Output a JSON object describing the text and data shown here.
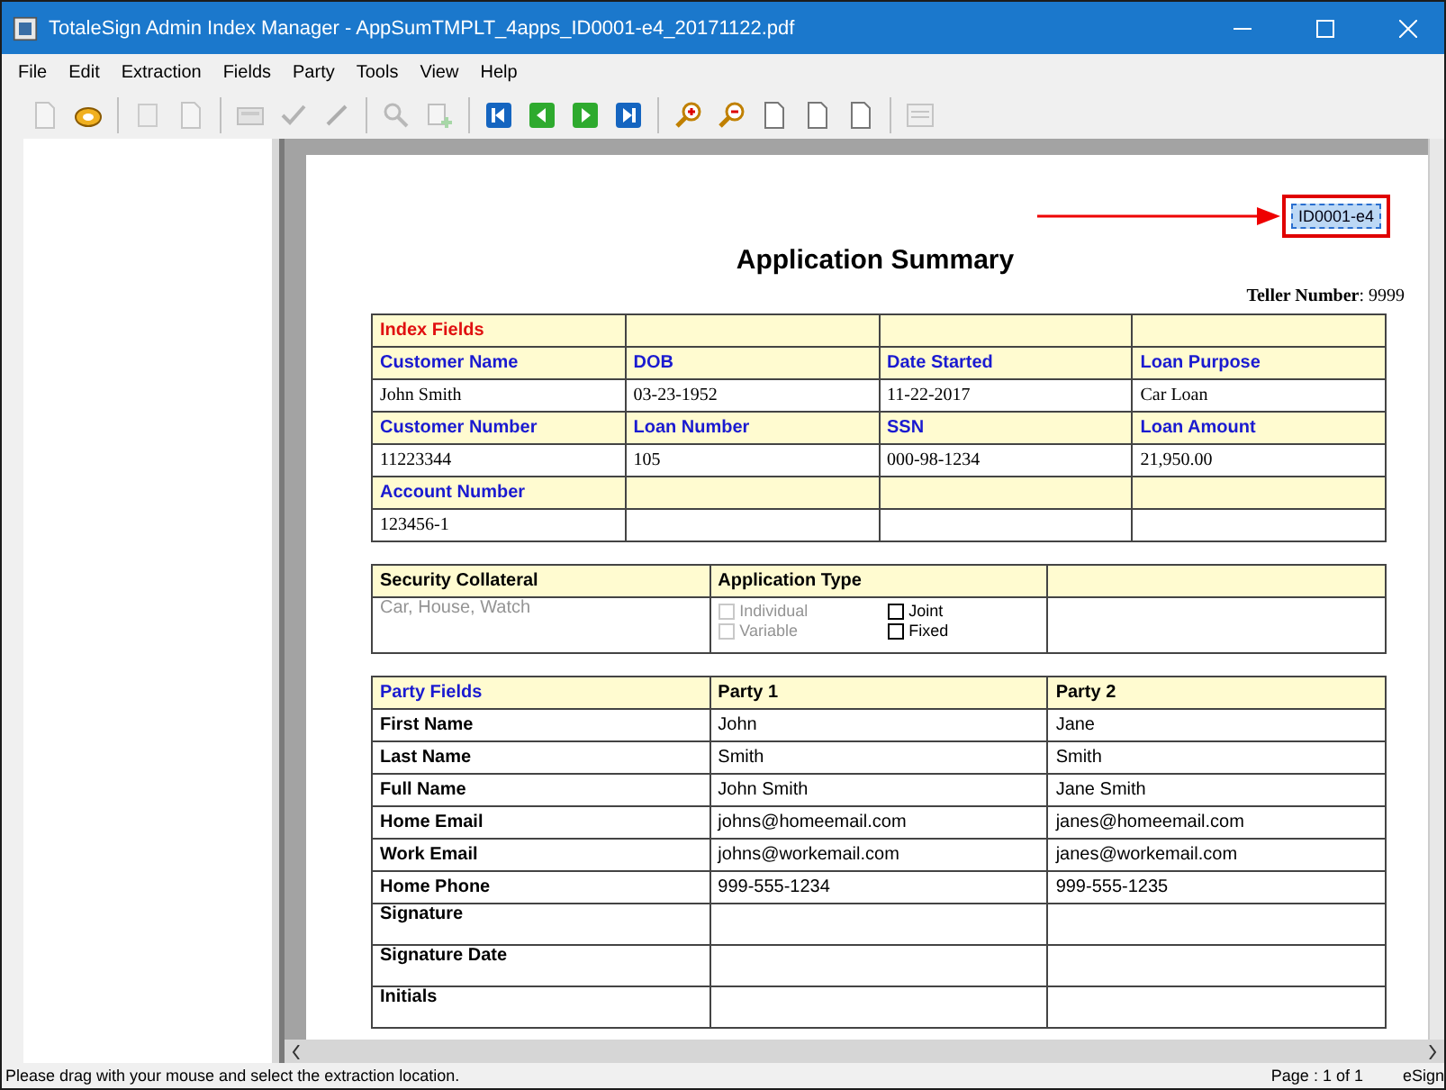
{
  "window": {
    "title": "TotaleSign Admin Index Manager - AppSumTMPLT_4apps_ID0001-e4_20171122.pdf"
  },
  "menu": [
    {
      "label": "File"
    },
    {
      "label": "Edit"
    },
    {
      "label": "Extraction"
    },
    {
      "label": "Fields"
    },
    {
      "label": "Party"
    },
    {
      "label": "Tools"
    },
    {
      "label": "View"
    },
    {
      "label": "Help"
    }
  ],
  "toolbar": [
    {
      "kind": "document",
      "disabled": true
    },
    {
      "kind": "tape",
      "disabled": false
    },
    {
      "kind": "separator"
    },
    {
      "kind": "blank",
      "disabled": true
    },
    {
      "kind": "document",
      "disabled": true
    },
    {
      "kind": "separator"
    },
    {
      "kind": "tray",
      "disabled": true
    },
    {
      "kind": "check",
      "disabled": true
    },
    {
      "kind": "pen",
      "disabled": true
    },
    {
      "kind": "separator"
    },
    {
      "kind": "search",
      "disabled": true
    },
    {
      "kind": "add",
      "disabled": true
    },
    {
      "kind": "separator"
    },
    {
      "kind": "first",
      "disabled": false
    },
    {
      "kind": "prev",
      "disabled": false
    },
    {
      "kind": "next",
      "disabled": false
    },
    {
      "kind": "last",
      "disabled": false
    },
    {
      "kind": "separator"
    },
    {
      "kind": "zoom-in",
      "disabled": false
    },
    {
      "kind": "zoom-out",
      "disabled": false
    },
    {
      "kind": "document",
      "disabled": false
    },
    {
      "kind": "document",
      "disabled": false
    },
    {
      "kind": "document",
      "disabled": false
    },
    {
      "kind": "separator"
    },
    {
      "kind": "list",
      "disabled": true
    }
  ],
  "document": {
    "id_tag": "ID0001-e4",
    "title": "Application Summary",
    "teller": "**Teller Number**: 9999",
    "index_table": [
      {
        "kind": "section",
        "cells": [
          "Index Fields"
        ]
      },
      {
        "kind": "label",
        "cells": [
          "Customer Name",
          "DOB",
          "Date Started",
          "Loan Purpose"
        ]
      },
      {
        "kind": "value",
        "cells": [
          "John Smith",
          "03-23-1952",
          "11-22-2017",
          "Car Loan"
        ]
      },
      {
        "kind": "label",
        "cells": [
          "Customer Number",
          "Loan Number",
          "SSN",
          "Loan Amount"
        ]
      },
      {
        "kind": "value",
        "cells": [
          "11223344",
          "105",
          "000-98-1234",
          "21,950.00"
        ]
      },
      {
        "kind": "label",
        "cells": [
          "Account Number"
        ]
      },
      {
        "kind": "value",
        "cells": [
          "123456-1"
        ]
      }
    ],
    "collateral_table": {
      "headers": [
        "Security Collateral",
        "Application Type"
      ],
      "collateral": {
        "text": "Car, House, Watch",
        "disabled": true
      },
      "options": [
        {
          "label": "Individual",
          "checked": false,
          "disabled": true
        },
        {
          "label": "Joint",
          "checked": false,
          "disabled": false
        },
        {
          "label": "Variable",
          "checked": false,
          "disabled": true
        },
        {
          "label": "Fixed",
          "checked": false,
          "disabled": false
        }
      ]
    },
    "party_table": {
      "headers": [
        "Party Fields",
        "Party 1",
        "Party 2"
      ],
      "rows": [
        {
          "kind": "data",
          "label": "First Name",
          "values": [
            "John",
            "Jane"
          ]
        },
        {
          "kind": "data",
          "label": "Last Name",
          "values": [
            "Smith",
            "Smith"
          ]
        },
        {
          "kind": "data",
          "label": "Full Name",
          "values": [
            "John Smith",
            "Jane Smith"
          ]
        },
        {
          "kind": "data",
          "label": "Home Email",
          "values": [
            "johns@homeemail.com",
            "janes@homeemail.com"
          ]
        },
        {
          "kind": "data",
          "label": "Work Email",
          "values": [
            "johns@workemail.com",
            "janes@workemail.com"
          ]
        },
        {
          "kind": "data",
          "label": "Home Phone",
          "values": [
            "999-555-1234",
            "999-555-1235"
          ]
        },
        {
          "kind": "signature",
          "label": "Signature"
        },
        {
          "kind": "signature",
          "label": "Signature Date"
        },
        {
          "kind": "signature",
          "label": "Initials"
        }
      ]
    }
  },
  "status_bar": {
    "message": "Please drag with your mouse and select the extraction location.",
    "page": "Page : 1 of 1",
    "product": "eSign"
  }
}
